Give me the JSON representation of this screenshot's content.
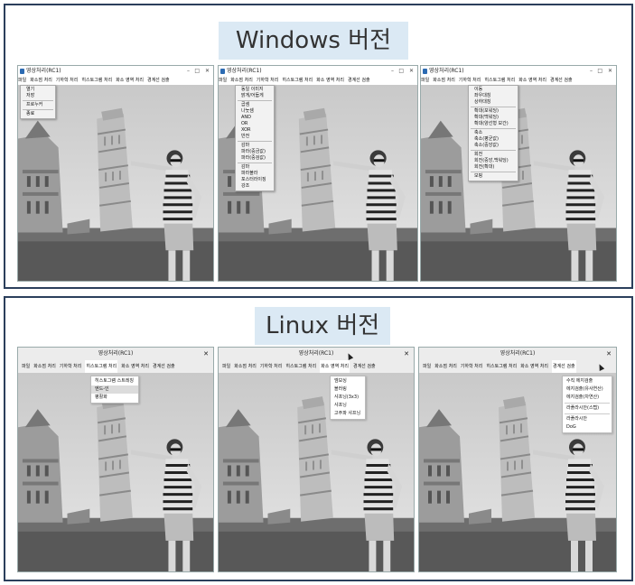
{
  "sections": {
    "windows_title": "Windows 버전",
    "linux_title": "Linux 버전"
  },
  "app": {
    "window_title": "영상처리(RC1)",
    "menu": [
      "파일",
      "화소점 처리",
      "기하학 처리",
      "히스토그램 처리",
      "화소 영역 처리",
      "경계선 검출"
    ],
    "minimize": "–",
    "maximize": "□",
    "close": "✕"
  },
  "windows": {
    "menu_file": [
      "열기",
      "저장",
      "",
      "프로누커",
      "",
      "종료"
    ],
    "menu_pixel": [
      "동일 이미지",
      "밝게/어둡게",
      "",
      "곱셈",
      "나눗셈",
      "AND",
      "OR",
      "XOR",
      "반전",
      "",
      "감마",
      "파라(중금값)",
      "파라(중검값)",
      "",
      "감마",
      "파라볼라",
      "포스터라이징",
      "강조"
    ],
    "menu_geo": [
      "이동",
      "좌우대칭",
      "상하대칭",
      "",
      "확대(포워딩)",
      "확대(백워딩)",
      "확대(양선형 보간)",
      "",
      "축소",
      "축소(평균값)",
      "축소(중앙값)",
      "",
      "회전",
      "회전(중앙,백워딩)",
      "회전(확대)",
      "",
      "모핑"
    ]
  },
  "linux": {
    "menu_hist": [
      "히스토그램 스트레칭",
      "엔드-인",
      "평활화"
    ],
    "menu_area": [
      "엠보싱",
      "블러링",
      "샤프닝(3x3)",
      "샤프닝",
      "고주파 샤프닝"
    ],
    "menu_edge": [
      "수직 에지검출",
      "에지검출(유사연산)",
      "에지검출(차연산)",
      "",
      "라플라시안(스텝)",
      "",
      "라플라시안",
      "DoG"
    ]
  },
  "colors": {
    "frame": "#2b3f5c",
    "badge_bg": "#dbe9f4"
  }
}
